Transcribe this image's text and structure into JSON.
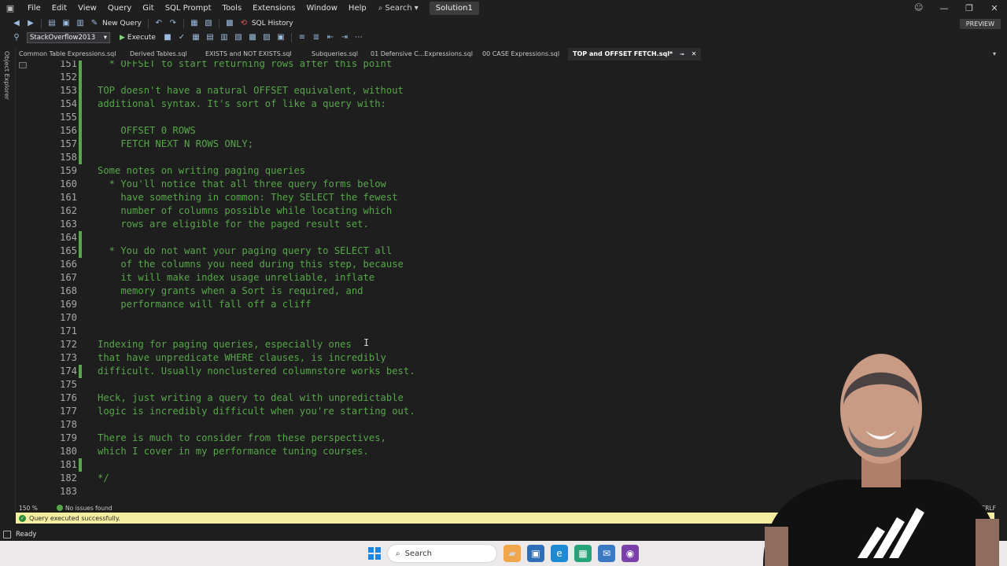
{
  "menubar": {
    "items": [
      "File",
      "Edit",
      "View",
      "Query",
      "Git",
      "SQL Prompt",
      "Tools",
      "Extensions",
      "Window",
      "Help"
    ],
    "search_label": "Search",
    "solution": "Solution1"
  },
  "toolbar": {
    "new_query_label": "New Query",
    "sql_history_label": "SQL History",
    "database": "StackOverflow2013",
    "execute_label": "Execute",
    "preview_label": "PREVIEW"
  },
  "object_explorer": {
    "label": "Object Explorer"
  },
  "tabs": [
    {
      "label": "Common Table Expressions.sql",
      "active": false
    },
    {
      "label": "Derived Tables.sql",
      "active": false
    },
    {
      "label": "EXISTS and NOT EXISTS.sql",
      "active": false
    },
    {
      "label": "Subqueries.sql",
      "active": false
    },
    {
      "label": "01 Defensive C...Expressions.sql",
      "active": false
    },
    {
      "label": "00 CASE Expressions.sql",
      "active": false
    },
    {
      "label": "TOP and OFFSET FETCH.sql*",
      "active": true
    }
  ],
  "editor": {
    "lines": [
      {
        "n": "151",
        "text": "  * OFFSET to start returning rows after this point",
        "changed": true
      },
      {
        "n": "152",
        "text": "",
        "changed": true
      },
      {
        "n": "153",
        "text": "TOP doesn't have a natural OFFSET equivalent, without",
        "changed": true
      },
      {
        "n": "154",
        "text": "additional syntax. It's sort of like a query with:",
        "changed": true
      },
      {
        "n": "155",
        "text": "",
        "changed": true
      },
      {
        "n": "156",
        "text": "    OFFSET 0 ROWS",
        "changed": true
      },
      {
        "n": "157",
        "text": "    FETCH NEXT N ROWS ONLY;",
        "changed": true
      },
      {
        "n": "158",
        "text": "",
        "changed": true
      },
      {
        "n": "159",
        "text": "Some notes on writing paging queries",
        "changed": false
      },
      {
        "n": "160",
        "text": "  * You'll notice that all three query forms below",
        "changed": false
      },
      {
        "n": "161",
        "text": "    have something in common: They SELECT the fewest",
        "changed": false
      },
      {
        "n": "162",
        "text": "    number of columns possible while locating which",
        "changed": false
      },
      {
        "n": "163",
        "text": "    rows are eligible for the paged result set.",
        "changed": false
      },
      {
        "n": "164",
        "text": "",
        "changed": true
      },
      {
        "n": "165",
        "text": "  * You do not want your paging query to SELECT all",
        "changed": true
      },
      {
        "n": "166",
        "text": "    of the columns you need during this step, because",
        "changed": false
      },
      {
        "n": "167",
        "text": "    it will make index usage unreliable, inflate",
        "changed": false
      },
      {
        "n": "168",
        "text": "    memory grants when a Sort is required, and",
        "changed": false
      },
      {
        "n": "169",
        "text": "    performance will fall off a cliff",
        "changed": false
      },
      {
        "n": "170",
        "text": "",
        "changed": false
      },
      {
        "n": "171",
        "text": "",
        "changed": false
      },
      {
        "n": "172",
        "text": "Indexing for paging queries, especially ones",
        "changed": false
      },
      {
        "n": "173",
        "text": "that have unpredicate WHERE clauses, is incredibly",
        "changed": false
      },
      {
        "n": "174",
        "text": "difficult. Usually nonclustered columnstore works best.",
        "changed": true
      },
      {
        "n": "175",
        "text": "",
        "changed": false
      },
      {
        "n": "176",
        "text": "Heck, just writing a query to deal with unpredictable",
        "changed": false
      },
      {
        "n": "177",
        "text": "logic is incredibly difficult when you're starting out.",
        "changed": false
      },
      {
        "n": "178",
        "text": "",
        "changed": false
      },
      {
        "n": "179",
        "text": "There is much to consider from these perspectives,",
        "changed": false
      },
      {
        "n": "180",
        "text": "which I cover in my performance tuning courses.",
        "changed": false
      },
      {
        "n": "181",
        "text": "",
        "changed": true
      },
      {
        "n": "182",
        "text": "*/",
        "changed": false
      },
      {
        "n": "183",
        "text": "",
        "changed": false
      }
    ]
  },
  "editor_status": {
    "zoom": "150 %",
    "issues": "No issues found",
    "line_ending": "CRLF"
  },
  "query_status": {
    "message": "Query executed successfully."
  },
  "app_status": {
    "text": "Ready"
  },
  "taskbar": {
    "search_placeholder": "Search"
  },
  "colors": {
    "comment_green": "#57a64a",
    "editor_bg": "#1e1e1e",
    "status_yellow": "#f5ed9f"
  }
}
